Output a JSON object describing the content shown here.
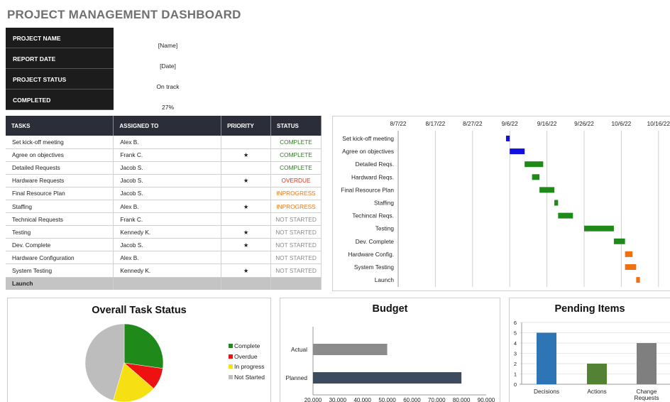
{
  "title": "PROJECT MANAGEMENT DASHBOARD",
  "info": [
    {
      "label": "PROJECT NAME",
      "value": "[Name]"
    },
    {
      "label": "REPORT DATE",
      "value": "[Date]"
    },
    {
      "label": "PROJECT STATUS",
      "value": "On track"
    },
    {
      "label": "COMPLETED",
      "value": "27%"
    }
  ],
  "table": {
    "headers": [
      "TASKS",
      "ASSIGNED TO",
      "PRIORITY",
      "STATUS"
    ],
    "rows": [
      {
        "task": "Set kick-off meeting",
        "assigned": "Alex B.",
        "priority": "",
        "status": "COMPLETE",
        "kind": "complete"
      },
      {
        "task": "Agree on objectives",
        "assigned": "Frank C.",
        "priority": "★",
        "status": "COMPLETE",
        "kind": "complete"
      },
      {
        "task": "Detailed Requests",
        "assigned": "Jacob S.",
        "priority": "",
        "status": "COMPLETE",
        "kind": "complete"
      },
      {
        "task": "Hardware Requests",
        "assigned": "Jacob S.",
        "priority": "★",
        "status": "OVERDUE",
        "kind": "overdue"
      },
      {
        "task": "Final Resource Plan",
        "assigned": "Jacob S.",
        "priority": "",
        "status": "INPROGRESS",
        "kind": "progress"
      },
      {
        "task": "Staffing",
        "assigned": "Alex B.",
        "priority": "★",
        "status": "INPROGRESS",
        "kind": "progress"
      },
      {
        "task": "Technical Requests",
        "assigned": "Frank C.",
        "priority": "",
        "status": "NOT STARTED",
        "kind": "notstarted"
      },
      {
        "task": "Testing",
        "assigned": "Kennedy K.",
        "priority": "★",
        "status": "NOT STARTED",
        "kind": "notstarted"
      },
      {
        "task": "Dev. Complete",
        "assigned": "Jacob S.",
        "priority": "★",
        "status": "NOT STARTED",
        "kind": "notstarted"
      },
      {
        "task": "Hardware Configuration",
        "assigned": "Alex B.",
        "priority": "",
        "status": "NOT STARTED",
        "kind": "notstarted"
      },
      {
        "task": "System Testing",
        "assigned": "Kennedy K.",
        "priority": "★",
        "status": "NOT STARTED",
        "kind": "notstarted"
      },
      {
        "task": "Launch",
        "assigned": "",
        "priority": "",
        "status": "",
        "kind": "last"
      }
    ]
  },
  "colors": {
    "complete": "#2f7d22",
    "overdue": "#e0301e",
    "progress": "#e9781c",
    "notstarted": "#8a8a8a",
    "gantt_blue": "#1010e0",
    "gantt_green": "#1f8a1a",
    "gantt_orange": "#f07010",
    "pie_green": "#1f8a1a",
    "pie_red": "#ee1111",
    "pie_yellow": "#f6e014",
    "pie_gray": "#bdbdbd",
    "budget_actual": "#8c8c8c",
    "budget_planned": "#3e4a5e",
    "pending_blue": "#2e75b6",
    "pending_green": "#548235",
    "pending_gray": "#7f7f7f"
  },
  "charts": {
    "task_status_title": "Overall Task Status",
    "budget_title": "Budget",
    "pending_title": "Pending Items"
  },
  "chart_data": [
    {
      "type": "gantt",
      "title": "",
      "x_ticks": [
        "8/7/22",
        "8/17/22",
        "8/27/22",
        "9/6/22",
        "9/16/22",
        "9/26/22",
        "10/6/22",
        "10/16/22"
      ],
      "tasks": [
        {
          "name": "Set kick-off meeting",
          "start": "9/5/22",
          "end": "9/6/22",
          "color": "blue"
        },
        {
          "name": "Agree on objectives",
          "start": "9/6/22",
          "end": "9/10/22",
          "color": "blue"
        },
        {
          "name": "Detailed Reqs.",
          "start": "9/10/22",
          "end": "9/15/22",
          "color": "green"
        },
        {
          "name": "Hardward Reqs.",
          "start": "9/12/22",
          "end": "9/14/22",
          "color": "green"
        },
        {
          "name": "Final Resource Plan",
          "start": "9/14/22",
          "end": "9/18/22",
          "color": "green"
        },
        {
          "name": "Staffing",
          "start": "9/18/22",
          "end": "9/19/22",
          "color": "green"
        },
        {
          "name": "Techincal Reqs.",
          "start": "9/19/22",
          "end": "9/23/22",
          "color": "green"
        },
        {
          "name": "Testing",
          "start": "9/26/22",
          "end": "10/4/22",
          "color": "green"
        },
        {
          "name": "Dev. Complete",
          "start": "10/4/22",
          "end": "10/7/22",
          "color": "green"
        },
        {
          "name": "Hardware Config.",
          "start": "10/7/22",
          "end": "10/9/22",
          "color": "orange"
        },
        {
          "name": "System Testing",
          "start": "10/7/22",
          "end": "10/10/22",
          "color": "orange"
        },
        {
          "name": "Launch",
          "start": "10/10/22",
          "end": "10/11/22",
          "color": "orange"
        }
      ]
    },
    {
      "type": "pie",
      "title": "Overall Task Status",
      "slices": [
        {
          "label": "Complete",
          "value": 3,
          "color": "#1f8a1a"
        },
        {
          "label": "Overdue",
          "value": 1,
          "color": "#ee1111"
        },
        {
          "label": "In progress",
          "value": 2,
          "color": "#f6e014"
        },
        {
          "label": "Not Started",
          "value": 5,
          "color": "#bdbdbd"
        }
      ],
      "legend": "right"
    },
    {
      "type": "bar",
      "orientation": "horizontal",
      "title": "Budget",
      "categories": [
        "Actual",
        "Planned"
      ],
      "values": [
        50000,
        80000
      ],
      "xlim": [
        20000,
        90000
      ],
      "x_ticks": [
        "20,000",
        "30,000",
        "40,000",
        "50,000",
        "60,000",
        "70,000",
        "80,000",
        "90,000"
      ]
    },
    {
      "type": "bar",
      "title": "Pending Items",
      "categories": [
        "Decisions",
        "Actions",
        "Change Requests"
      ],
      "values": [
        5,
        2,
        4
      ],
      "ylim": [
        0,
        6
      ],
      "y_ticks": [
        "0",
        "1",
        "2",
        "3",
        "4",
        "5",
        "6"
      ]
    }
  ]
}
